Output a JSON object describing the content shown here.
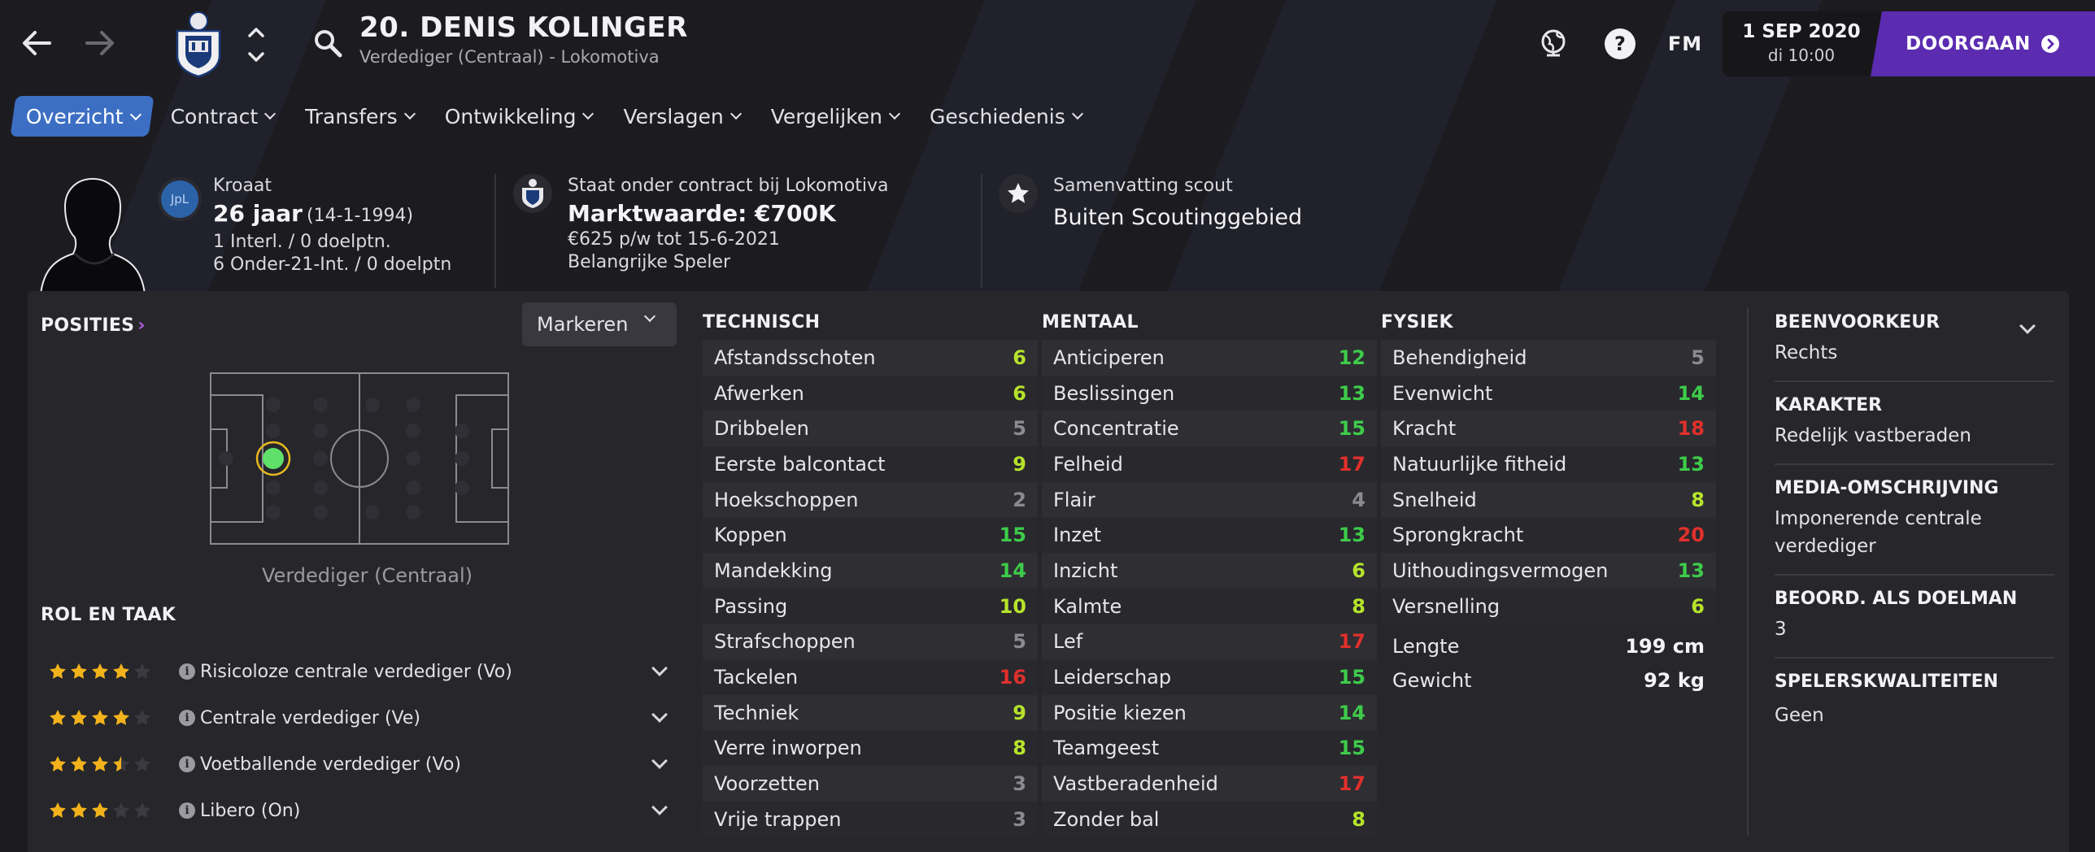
{
  "colors": {
    "accent_purple": "#5b2bb0",
    "tab_active": "#3c6fc4",
    "val_green": "#3ecb4a",
    "val_yellowgreen": "#b6e32b",
    "val_gray": "#8a8a90",
    "val_red": "#e0302c",
    "star": "#f2b21b"
  },
  "header": {
    "player_name": "20. DENIS KOLINGER",
    "player_subtitle": "Verdediger (Centraal) - Lokomotiva",
    "date": "1 SEP 2020",
    "time": "di 10:00",
    "continue_label": "DOORGAAN",
    "fm_label": "FM"
  },
  "tabs": [
    {
      "label": "Overzicht",
      "active": true
    },
    {
      "label": "Contract"
    },
    {
      "label": "Transfers"
    },
    {
      "label": "Ontwikkeling"
    },
    {
      "label": "Verslagen"
    },
    {
      "label": "Vergelijken"
    },
    {
      "label": "Geschiedenis"
    }
  ],
  "profile": {
    "nationality": "Kroaat",
    "league_badge": "JpL",
    "age": "26 jaar",
    "birthdate": "(14-1-1994)",
    "caps": "1 Interl. / 0 doelptn.",
    "u21_caps": "6 Onder-21-Int. / 0 doelptn",
    "contract_status": "Staat onder contract bij Lokomotiva",
    "market_value": "Marktwaarde: €700K",
    "wage": "€625 p/w tot 15-6-2021",
    "squad_status": "Belangrijke Speler",
    "scout_title": "Samenvatting scout",
    "scout_value": "Buiten Scoutinggebied"
  },
  "positions": {
    "heading": "POSITIES",
    "dropdown_label": "Markeren",
    "position_label": "Verdediger (Centraal)"
  },
  "roles": {
    "heading": "ROL EN TAAK",
    "items": [
      {
        "name": "Risicoloze centrale verdediger (Vo)",
        "stars": 4
      },
      {
        "name": "Centrale verdediger (Ve)",
        "stars": 4
      },
      {
        "name": "Voetballende verdediger (Vo)",
        "stars": 3.5
      },
      {
        "name": "Libero (On)",
        "stars": 3
      }
    ]
  },
  "technical": {
    "heading": "TECHNISCH",
    "rows": [
      {
        "name": "Afstandsschoten",
        "value": "6"
      },
      {
        "name": "Afwerken",
        "value": "6"
      },
      {
        "name": "Dribbelen",
        "value": "5"
      },
      {
        "name": "Eerste balcontact",
        "value": "9"
      },
      {
        "name": "Hoekschoppen",
        "value": "2"
      },
      {
        "name": "Koppen",
        "value": "15"
      },
      {
        "name": "Mandekking",
        "value": "14"
      },
      {
        "name": "Passing",
        "value": "10"
      },
      {
        "name": "Strafschoppen",
        "value": "5"
      },
      {
        "name": "Tackelen",
        "value": "16"
      },
      {
        "name": "Techniek",
        "value": "9"
      },
      {
        "name": "Verre inworpen",
        "value": "8"
      },
      {
        "name": "Voorzetten",
        "value": "3"
      },
      {
        "name": "Vrije trappen",
        "value": "3"
      }
    ]
  },
  "mental": {
    "heading": "MENTAAL",
    "rows": [
      {
        "name": "Anticiperen",
        "value": "12"
      },
      {
        "name": "Beslissingen",
        "value": "13"
      },
      {
        "name": "Concentratie",
        "value": "15"
      },
      {
        "name": "Felheid",
        "value": "17"
      },
      {
        "name": "Flair",
        "value": "4"
      },
      {
        "name": "Inzet",
        "value": "13"
      },
      {
        "name": "Inzicht",
        "value": "6"
      },
      {
        "name": "Kalmte",
        "value": "8"
      },
      {
        "name": "Lef",
        "value": "17"
      },
      {
        "name": "Leiderschap",
        "value": "15"
      },
      {
        "name": "Positie kiezen",
        "value": "14"
      },
      {
        "name": "Teamgeest",
        "value": "15"
      },
      {
        "name": "Vastberadenheid",
        "value": "17"
      },
      {
        "name": "Zonder bal",
        "value": "8"
      }
    ]
  },
  "physical": {
    "heading": "FYSIEK",
    "rows": [
      {
        "name": "Behendigheid",
        "value": "5"
      },
      {
        "name": "Evenwicht",
        "value": "14"
      },
      {
        "name": "Kracht",
        "value": "18"
      },
      {
        "name": "Natuurlijke fitheid",
        "value": "13"
      },
      {
        "name": "Snelheid",
        "value": "8"
      },
      {
        "name": "Sprongkracht",
        "value": "20"
      },
      {
        "name": "Uithoudingsvermogen",
        "value": "13"
      },
      {
        "name": "Versnelling",
        "value": "6"
      }
    ],
    "height_label": "Lengte",
    "height_value": "199 cm",
    "weight_label": "Gewicht",
    "weight_value": "92 kg"
  },
  "side_info": {
    "foot_heading": "BEENVOORKEUR",
    "foot_value": "Rechts",
    "character_heading": "KARAKTER",
    "character_value": "Redelijk vastberaden",
    "media_heading": "MEDIA-OMSCHRIJVING",
    "media_value": "Imponerende centrale verdediger",
    "gk_heading": "BEOORD. ALS DOELMAN",
    "gk_value": "3",
    "traits_heading": "SPELERSKWALITEITEN",
    "traits_value": "Geen"
  }
}
